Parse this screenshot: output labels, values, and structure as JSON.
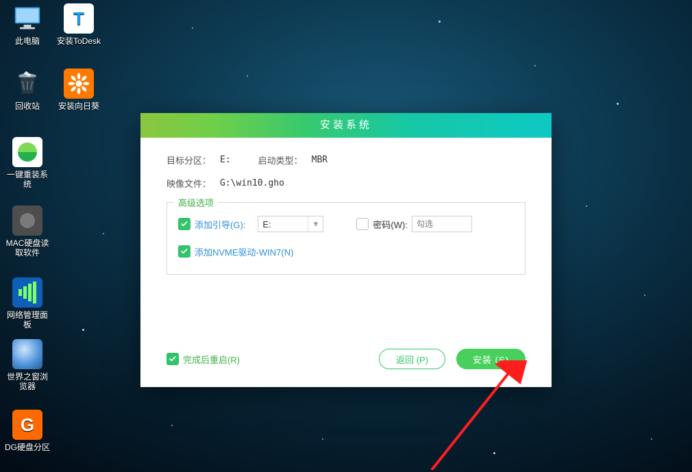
{
  "desktop_icons": {
    "thispc": "此电脑",
    "todesk": "安装ToDesk",
    "recycle": "回收站",
    "sun": "安装向日葵",
    "reinstall": "一键重装系统",
    "machdd": "MAC硬盘读取软件",
    "netpanel": "网络管理面板",
    "browser": "世界之窗浏览器",
    "dg": "DG硬盘分区"
  },
  "dialog": {
    "title": "安装系统",
    "target_label": "目标分区：",
    "target_value": "E:",
    "boot_label": "启动类型：",
    "boot_value": "MBR",
    "image_label": "映像文件：",
    "image_value": "G:\\win10.gho",
    "adv_title": "高级选项",
    "add_boot_label": "添加引导(G):",
    "add_boot_value": "E:",
    "pwd_label": "密码(W):",
    "pwd_placeholder": "勾选",
    "nvme_label": "添加NVME驱动-WIN7(N)",
    "restart_label": "完成后重启(R)",
    "back_btn": "返回 (P)",
    "install_btn": "安装 (S)"
  }
}
